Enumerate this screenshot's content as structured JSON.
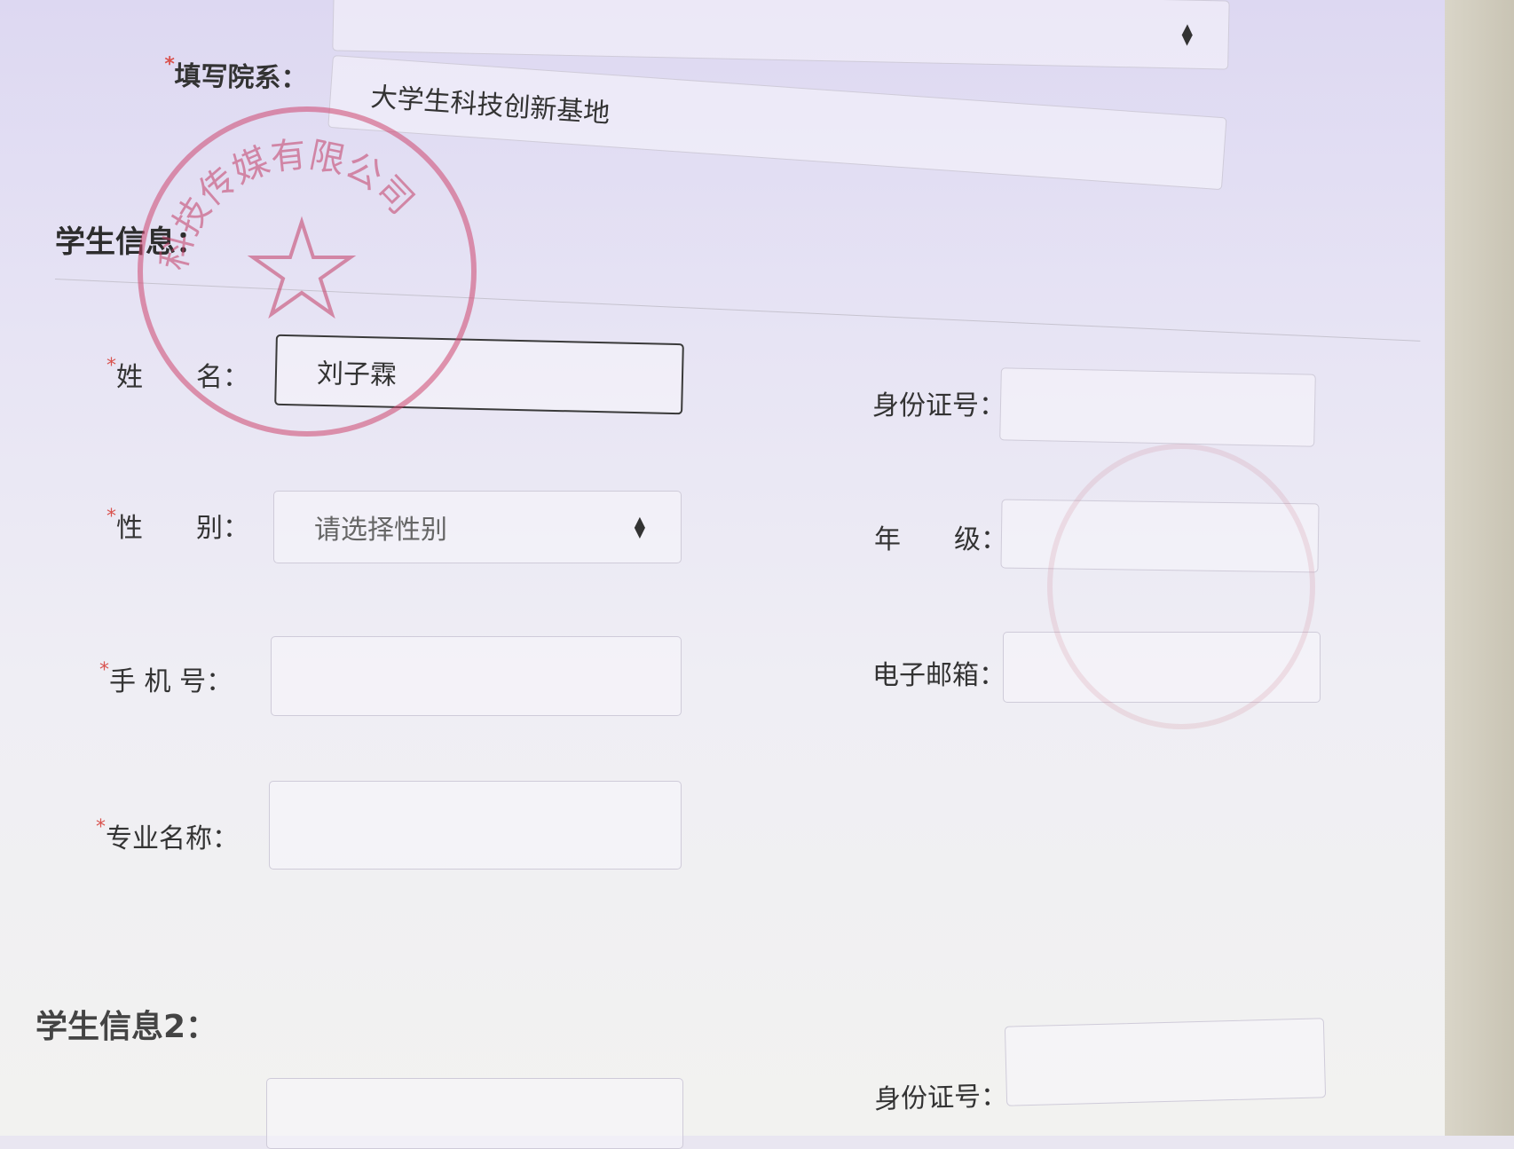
{
  "top_select": {
    "value": ""
  },
  "department": {
    "label": "填写院系：",
    "value": "大学生科技创新基地"
  },
  "student_info": {
    "title": "学生信息：",
    "name": {
      "label": "姓　　名：",
      "value": "刘子霖"
    },
    "gender": {
      "label": "性　　别：",
      "placeholder": "请选择性别"
    },
    "phone": {
      "label": "手 机 号：",
      "value": ""
    },
    "major": {
      "label": "专业名称：",
      "value": ""
    },
    "id_number": {
      "label": "身份证号：",
      "value": ""
    },
    "grade": {
      "label": "年　　级：",
      "value": ""
    },
    "email": {
      "label": "电子邮箱：",
      "value": ""
    }
  },
  "student_info2": {
    "title": "学生信息2：",
    "id_number": {
      "label": "身份证号："
    }
  },
  "stamp": {
    "text": "科技传媒有限公司"
  },
  "required_mark": "*"
}
